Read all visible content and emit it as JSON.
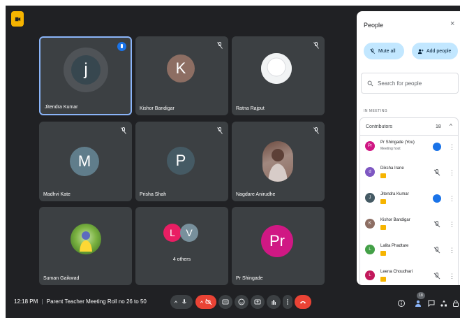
{
  "tiles": [
    {
      "name": "Jitendra Kumar",
      "initial": "j"
    },
    {
      "name": "Kishor Bandigar",
      "initial": "K"
    },
    {
      "name": "Ratna Rajput"
    },
    {
      "name": "Madhvi Kate",
      "initial": "M"
    },
    {
      "name": "Prisha Shah",
      "initial": "P"
    },
    {
      "name": "Nagdare Anirudhe"
    },
    {
      "name": "Suman Gaikwad"
    },
    {
      "name": "",
      "initial_1": "L",
      "initial_2": "V",
      "others": "4 others"
    },
    {
      "name": "Pr Shingade",
      "initial": "Pr"
    }
  ],
  "bottom_bar": {
    "time": "12:18 PM",
    "separator": "|",
    "meeting_title": "Parent Teacher Meeting Roll no 26 to 50",
    "participant_count": "18"
  },
  "panel": {
    "title": "People",
    "close": "×",
    "mute_all": "Mute all",
    "add_people": "Add people",
    "search_placeholder": "Search for people",
    "in_meeting": "IN MEETING",
    "contributors_label": "Contributors",
    "contributors_count": "18",
    "chevron": "^",
    "participants": [
      {
        "name": "Pr Shingade (You)",
        "sub": "Meeting host",
        "initial": "Pr",
        "color": "#d01884",
        "status": "speaking"
      },
      {
        "name": "Diksha Irane",
        "initial": "d",
        "color": "#7e57c2",
        "status": "muted"
      },
      {
        "name": "Jitendra Kumar",
        "initial": "J",
        "color": "#455a64",
        "status": "active"
      },
      {
        "name": "Kishor Bandigar",
        "initial": "K",
        "color": "#8d6e63",
        "status": "muted"
      },
      {
        "name": "Lalita Phadtare",
        "initial": "L",
        "color": "#43a047",
        "status": "muted"
      },
      {
        "name": "Leena Choudhari",
        "initial": "L",
        "color": "#c2185b",
        "status": "muted"
      }
    ],
    "more": "⋮"
  },
  "colors": {
    "background": "#202124",
    "tile": "#3c4043",
    "accent": "#1a73e8",
    "hangup": "#ea4335",
    "pill": "#c2e7ff",
    "logo": "#f6b400"
  }
}
